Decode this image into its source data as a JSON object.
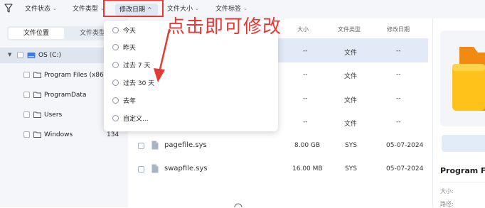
{
  "toolbar": {
    "filters": [
      {
        "label": "文件状态"
      },
      {
        "label": "文件类型"
      },
      {
        "label": "修改日期"
      },
      {
        "label": "文件大小"
      },
      {
        "label": "文件标签"
      }
    ],
    "chevron_down": "⌄",
    "chevron_up": "^",
    "active_filter_index": 2
  },
  "left_panel": {
    "tabs": [
      "文件位置",
      "文件类型"
    ],
    "drive": {
      "label": "OS (C:)"
    },
    "folders": [
      {
        "label": "Program Files (x86)",
        "count": ""
      },
      {
        "label": "ProgramData",
        "count": ""
      },
      {
        "label": "Users",
        "count": ""
      },
      {
        "label": "Windows",
        "count": "134"
      }
    ]
  },
  "table": {
    "headers": {
      "size": "大小",
      "type": "文件类型",
      "date": "修改日期"
    },
    "rows": [
      {
        "name": "",
        "size": "--",
        "type": "文件",
        "date": "--"
      },
      {
        "name": "",
        "size": "--",
        "type": "文件",
        "date": "--"
      },
      {
        "name": "",
        "size": "--",
        "type": "文件",
        "date": "--"
      },
      {
        "name": "",
        "size": "--",
        "type": "文件",
        "date": "--"
      },
      {
        "name": "pagefile.sys",
        "size": "8.00 GB",
        "type": "SYS",
        "date": "05-07-2024"
      },
      {
        "name": "swapfile.sys",
        "size": "16.00 MB",
        "type": "SYS",
        "date": "05-07-2024"
      }
    ]
  },
  "preview": {
    "title": "Program Fi",
    "size_label": "大小:",
    "path_label": "路径:"
  },
  "dropdown": {
    "options": [
      "今天",
      "昨天",
      "过去 7 天",
      "过去 30 天",
      "去年",
      "自定义..."
    ]
  },
  "annotation": {
    "text": "点击即可修改"
  },
  "colors": {
    "highlight": "#e53935",
    "folder": "#f5a623",
    "drive": "#3d7be0",
    "accent": "#dfe6f3"
  }
}
